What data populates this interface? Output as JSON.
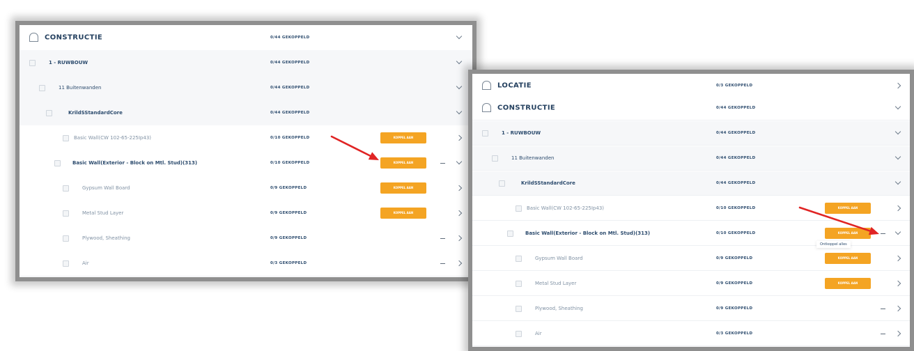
{
  "left": {
    "rows": [
      {
        "label": "CONSTRUCTIE",
        "status": "0/44 GEKOPPELD",
        "expanded": true
      },
      {
        "label": "1 - RUWBOUW",
        "status": "0/44 GEKOPPELD",
        "expanded": true
      },
      {
        "label": "11 Buitenwanden",
        "status": "0/44 GEKOPPELD",
        "expanded": true
      },
      {
        "label": "KrildSStandardCore",
        "status": "0/44 GEKOPPELD",
        "expanded": true
      },
      {
        "label": "Basic Wall(CW 102-65-225Ip43)",
        "status": "0/10 GEKOPPELD",
        "button": "KOPPEL AAN",
        "expanded": false
      },
      {
        "label": "Basic Wall(Exterior - Block on Mtl. Stud)(313)",
        "status": "0/10 GEKOPPELD",
        "button": "KOPPEL AAN",
        "expanded": true,
        "dash": true
      },
      {
        "label": "Gypsum Wall Board",
        "status": "0/9 GEKOPPELD",
        "button": "KOPPEL AAN",
        "expanded": false
      },
      {
        "label": "Metal Stud Layer",
        "status": "0/9 GEKOPPELD",
        "button": "KOPPEL AAN",
        "expanded": false
      },
      {
        "label": "Plywood, Sheathing",
        "status": "0/9 GEKOPPELD",
        "expanded": false,
        "dash": true
      },
      {
        "label": "Air",
        "status": "0/3 GEKOPPELD",
        "expanded": false,
        "dash": true
      }
    ]
  },
  "right": {
    "rows": [
      {
        "label": "LOCATIE",
        "status": "0/3 GEKOPPELD",
        "expanded": false
      },
      {
        "label": "CONSTRUCTIE",
        "status": "0/44 GEKOPPELD",
        "expanded": true
      },
      {
        "label": "1 - RUWBOUW",
        "status": "0/44 GEKOPPELD",
        "expanded": true
      },
      {
        "label": "11 Buitenwanden",
        "status": "0/44 GEKOPPELD",
        "expanded": true
      },
      {
        "label": "KrildSStandardCore",
        "status": "0/44 GEKOPPELD",
        "expanded": true
      },
      {
        "label": "Basic Wall(CW 102-65-225Ip43)",
        "status": "0/10 GEKOPPELD",
        "button": "KOPPEL AAN",
        "expanded": false
      },
      {
        "label": "Basic Wall(Exterior - Block on Mtl. Stud)(313)",
        "status": "0/10 GEKOPPELD",
        "button": "KOPPEL AAN",
        "expanded": true,
        "dash": true
      },
      {
        "label": "Gypsum Wall Board",
        "status": "0/9 GEKOPPELD",
        "button": "KOPPEL AAN",
        "expanded": false
      },
      {
        "label": "Metal Stud Layer",
        "status": "0/9 GEKOPPELD",
        "button": "KOPPEL AAN",
        "expanded": false
      },
      {
        "label": "Plywood, Sheathing",
        "status": "0/9 GEKOPPELD",
        "expanded": false,
        "dash": true
      },
      {
        "label": "Air",
        "status": "0/3 GEKOPPELD",
        "expanded": false,
        "dash": true
      }
    ],
    "tooltip": "Ontkoppel alles"
  },
  "colors": {
    "accent_button": "#f4a423",
    "text_primary": "#2d4c6e",
    "annotation_arrow": "#e02424"
  }
}
